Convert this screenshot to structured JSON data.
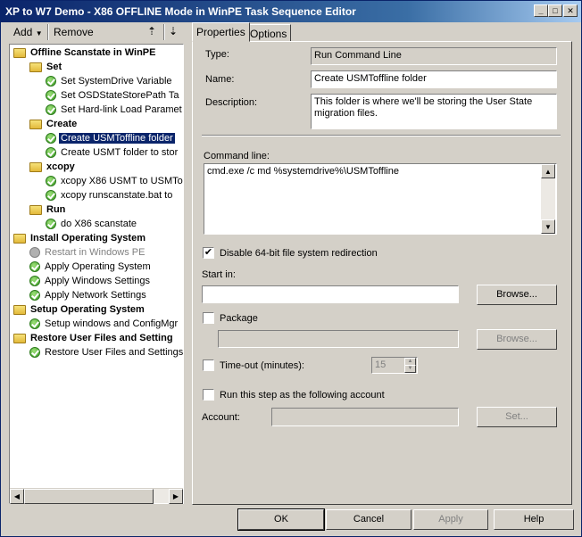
{
  "window": {
    "title": "XP to W7 Demo - X86 OFFLINE Mode in WinPE Task Sequence Editor"
  },
  "toolbar": {
    "add_label": "Add",
    "remove_label": "Remove"
  },
  "tree": {
    "items": [
      {
        "label": "Offline Scanstate in WinPE",
        "kind": "group",
        "icon": "folder-icon",
        "level": 0
      },
      {
        "label": "Set",
        "kind": "group",
        "icon": "folder-icon",
        "level": 1
      },
      {
        "label": "Set SystemDrive Variable",
        "kind": "step",
        "icon": "check-icon",
        "level": 2
      },
      {
        "label": "Set OSDStateStorePath Ta",
        "kind": "step",
        "icon": "check-icon",
        "level": 2
      },
      {
        "label": "Set Hard-link Load Paramet",
        "kind": "step",
        "icon": "check-icon",
        "level": 2
      },
      {
        "label": "Create",
        "kind": "group",
        "icon": "folder-icon",
        "level": 1
      },
      {
        "label": "Create USMToffline folder",
        "kind": "step",
        "icon": "check-icon",
        "level": 2,
        "selected": true
      },
      {
        "label": "Create USMT folder to stor",
        "kind": "step",
        "icon": "check-icon",
        "level": 2
      },
      {
        "label": "xcopy",
        "kind": "group",
        "icon": "folder-icon",
        "level": 1
      },
      {
        "label": "xcopy X86 USMT to USMTo",
        "kind": "step",
        "icon": "check-icon",
        "level": 2
      },
      {
        "label": "xcopy runscanstate.bat to",
        "kind": "step",
        "icon": "check-icon",
        "level": 2
      },
      {
        "label": "Run",
        "kind": "group",
        "icon": "folder-icon",
        "level": 1
      },
      {
        "label": "do X86 scanstate",
        "kind": "step",
        "icon": "check-icon",
        "level": 2
      },
      {
        "label": "Install Operating System",
        "kind": "group",
        "icon": "folder-icon",
        "level": 0
      },
      {
        "label": "Restart in Windows PE",
        "kind": "step",
        "icon": "disabled-step-icon",
        "level": 1,
        "disabled": true
      },
      {
        "label": "Apply Operating System",
        "kind": "step",
        "icon": "check-icon",
        "level": 1
      },
      {
        "label": "Apply Windows Settings",
        "kind": "step",
        "icon": "check-icon",
        "level": 1
      },
      {
        "label": "Apply Network Settings",
        "kind": "step",
        "icon": "check-icon",
        "level": 1
      },
      {
        "label": "Setup Operating System",
        "kind": "group",
        "icon": "folder-icon",
        "level": 0
      },
      {
        "label": "Setup windows and ConfigMgr",
        "kind": "step",
        "icon": "check-icon",
        "level": 1
      },
      {
        "label": "Restore User Files and Setting",
        "kind": "group",
        "icon": "folder-icon",
        "level": 0
      },
      {
        "label": "Restore User Files and Settings",
        "kind": "step",
        "icon": "check-icon",
        "level": 1
      }
    ]
  },
  "tabs": [
    {
      "label": "Properties",
      "active": true
    },
    {
      "label": "Options",
      "active": false
    }
  ],
  "properties": {
    "type_label": "Type:",
    "type_value": "Run Command Line",
    "name_label": "Name:",
    "name_value": "Create USMToffline folder",
    "description_label": "Description:",
    "description_value": "This folder is where we'll be storing the User State migration files.",
    "command_line_label": "Command line:",
    "command_line_value": "cmd.exe /c md %systemdrive%\\USMToffline",
    "disable_redirection_label": "Disable 64-bit file system redirection",
    "start_in_label": "Start in:",
    "start_in_value": "",
    "browse_label": "Browse...",
    "package_label": "Package",
    "package_value": "",
    "package_browse_label": "Browse...",
    "timeout_label": "Time-out (minutes):",
    "timeout_value": "15",
    "run_as_label": "Run this step as the following account",
    "account_label": "Account:",
    "account_value": "",
    "set_label": "Set..."
  },
  "footer": {
    "ok_label": "OK",
    "cancel_label": "Cancel",
    "apply_label": "Apply",
    "help_label": "Help"
  }
}
